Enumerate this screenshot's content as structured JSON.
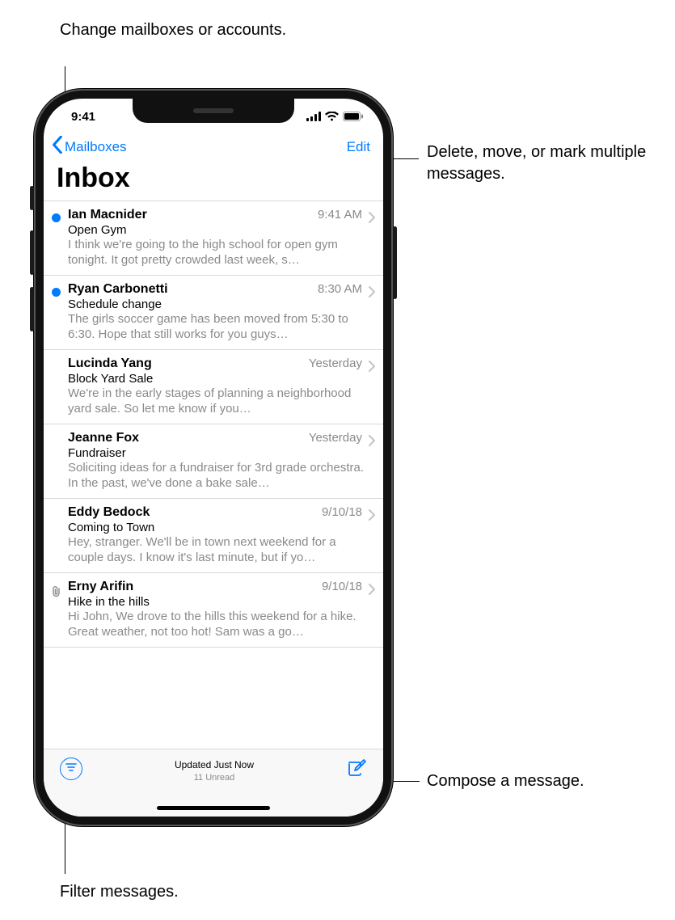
{
  "status": {
    "time": "9:41"
  },
  "nav": {
    "back_label": "Mailboxes",
    "edit_label": "Edit",
    "title": "Inbox"
  },
  "messages": [
    {
      "sender": "Ian Macnider",
      "time": "9:41 AM",
      "subject": "Open Gym",
      "preview": "I think we're going to the high school for open gym tonight. It got pretty crowded last week, s…",
      "unread": true,
      "attachment": false
    },
    {
      "sender": "Ryan Carbonetti",
      "time": "8:30 AM",
      "subject": "Schedule change",
      "preview": "The girls soccer game has been moved from 5:30 to 6:30. Hope that still works for you guys…",
      "unread": true,
      "attachment": false
    },
    {
      "sender": "Lucinda Yang",
      "time": "Yesterday",
      "subject": "Block Yard Sale",
      "preview": "We're in the early stages of planning a neighborhood yard sale. So let me know if you…",
      "unread": false,
      "attachment": false
    },
    {
      "sender": "Jeanne Fox",
      "time": "Yesterday",
      "subject": "Fundraiser",
      "preview": "Soliciting ideas for a fundraiser for 3rd grade orchestra. In the past, we've done a bake sale…",
      "unread": false,
      "attachment": false
    },
    {
      "sender": "Eddy Bedock",
      "time": "9/10/18",
      "subject": "Coming to Town",
      "preview": "Hey, stranger. We'll be in town next weekend for a couple days. I know it's last minute, but if yo…",
      "unread": false,
      "attachment": false
    },
    {
      "sender": "Erny Arifin",
      "time": "9/10/18",
      "subject": "Hike in the hills",
      "preview": "Hi John, We drove to the hills this weekend for a hike. Great weather, not too hot! Sam was a go…",
      "unread": false,
      "attachment": true
    }
  ],
  "toolbar": {
    "status_line": "Updated Just Now",
    "unread_line": "11 Unread"
  },
  "callouts": {
    "mailboxes": "Change mailboxes or accounts.",
    "edit": "Delete, move, or mark multiple messages.",
    "compose": "Compose a message.",
    "filter": "Filter messages."
  },
  "colors": {
    "tint": "#007aff",
    "secondary": "#8a8a8e"
  }
}
